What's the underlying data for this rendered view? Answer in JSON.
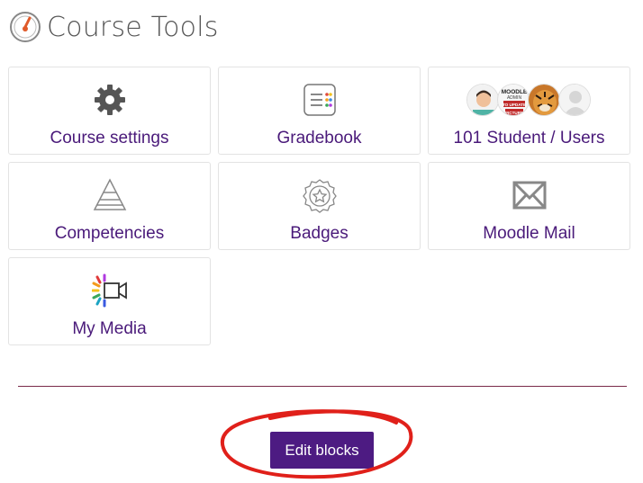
{
  "page": {
    "title": "Course Tools"
  },
  "tools": [
    {
      "label": "Course settings",
      "icon": "gear-icon"
    },
    {
      "label": "Gradebook",
      "icon": "gradebook-icon"
    },
    {
      "label": "101 Student / Users",
      "icon": "user-avatars"
    },
    {
      "label": "Competencies",
      "icon": "pyramid-icon"
    },
    {
      "label": "Badges",
      "icon": "badge-icon"
    },
    {
      "label": "Moodle Mail",
      "icon": "envelope-icon"
    },
    {
      "label": "My Media",
      "icon": "video-camera-icon"
    }
  ],
  "avatar_text": {
    "line1": "MOODLE",
    "line2": "ADMIN",
    "line3": "TO UPDATE",
    "line4": "PICTURE"
  },
  "actions": {
    "edit_blocks": "Edit blocks"
  },
  "colors": {
    "link": "#4a1a7a",
    "button": "#4d1b82",
    "divider": "#7a2a4a",
    "annotation": "#e0201a"
  }
}
